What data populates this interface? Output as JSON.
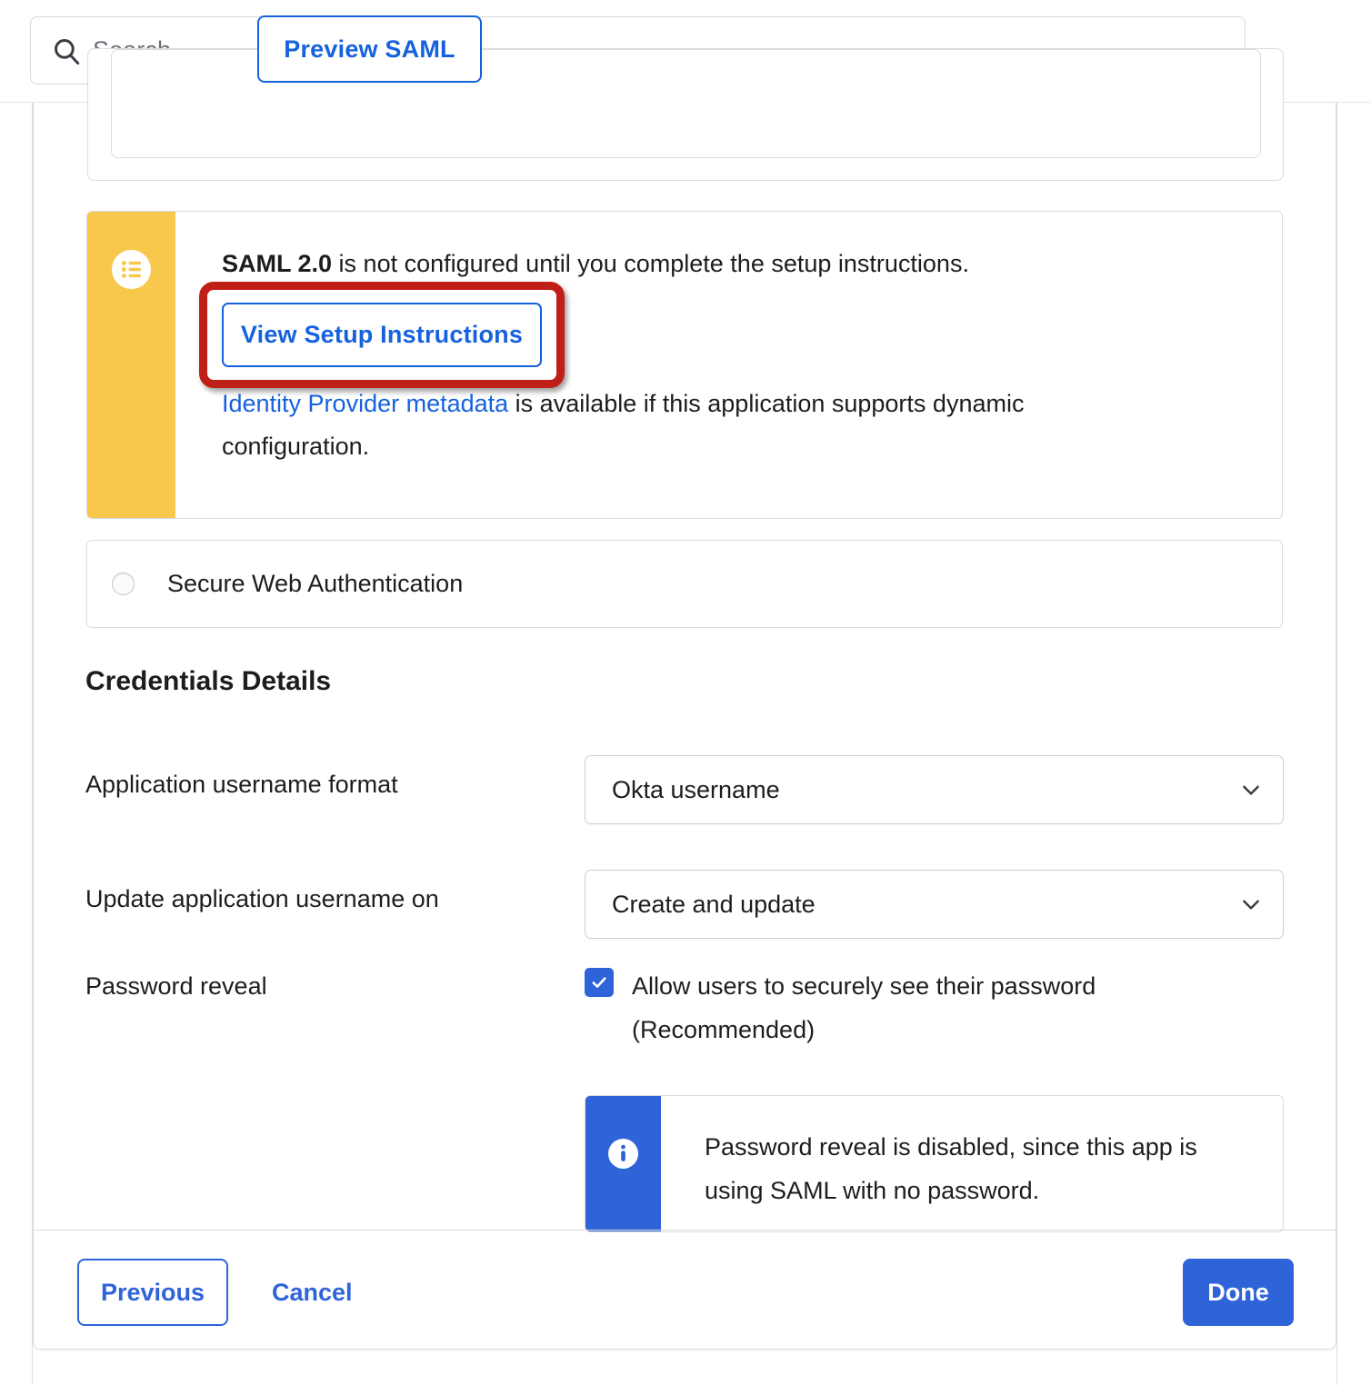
{
  "search": {
    "placeholder": "Search...",
    "icon": "search-icon"
  },
  "top_panel": {
    "preview_saml_label": "Preview SAML"
  },
  "warning_banner": {
    "icon": "list-circle-icon",
    "stripe_color": "#f7c84b",
    "title_strong": "SAML 2.0",
    "title_rest": " is not configured until you complete the setup instructions.",
    "view_setup_button": "View Setup Instructions",
    "metadata_link": "Identity Provider metadata",
    "metadata_rest": " is available if this application supports dynamic configuration.",
    "annotation_color": "#c01f17"
  },
  "secure_web_auth": {
    "label": "Secure Web Authentication",
    "selected": false
  },
  "credentials": {
    "section_title": "Credentials Details",
    "fields": [
      {
        "label": "Application username format",
        "value": "Okta username",
        "chevron": "chevron-down-icon"
      },
      {
        "label": "Update application username on",
        "value": "Create and update",
        "chevron": "chevron-down-icon"
      }
    ],
    "password_reveal": {
      "label": "Password reveal",
      "checkbox_checked": true,
      "checkbox_label": "Allow users to securely see their password (Recommended)",
      "callout": {
        "icon": "info-circle-icon",
        "stripe_color": "#2f63d8",
        "text": "Password reveal is disabled, since this app is using SAML with no password."
      }
    }
  },
  "footer": {
    "previous_label": "Previous",
    "cancel_label": "Cancel",
    "done_label": "Done",
    "accent_color": "#2f63d8"
  }
}
